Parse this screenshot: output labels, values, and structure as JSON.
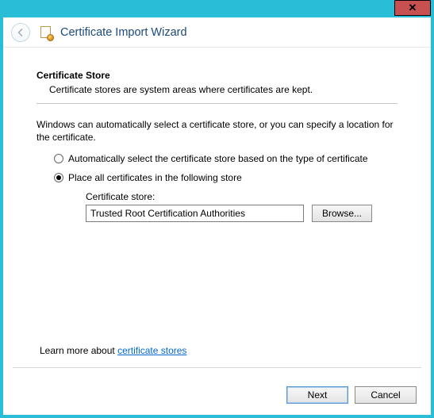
{
  "window": {
    "title": "Certificate Import Wizard"
  },
  "page": {
    "heading": "Certificate Store",
    "subheading": "Certificate stores are system areas where certificates are kept.",
    "intro": "Windows can automatically select a certificate store, or you can specify a location for the certificate.",
    "radios": {
      "auto": "Automatically select the certificate store based on the type of certificate",
      "place": "Place all certificates in the following store",
      "selected": "place"
    },
    "store": {
      "label": "Certificate store:",
      "value": "Trusted Root Certification Authorities",
      "browse": "Browse..."
    },
    "learn": {
      "prefix": "Learn more about ",
      "link": "certificate stores"
    }
  },
  "footer": {
    "next": "Next",
    "cancel": "Cancel"
  }
}
